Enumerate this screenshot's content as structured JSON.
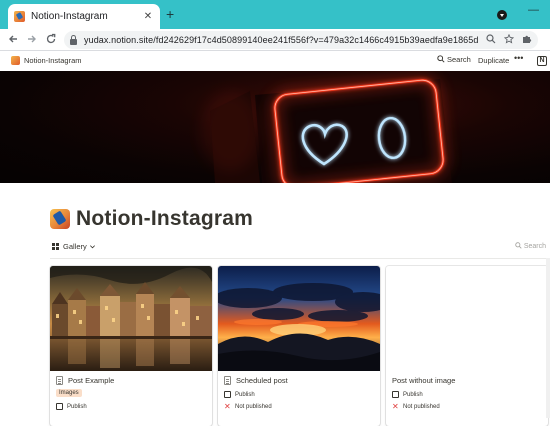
{
  "browser": {
    "tab_title": "Notion-Instagram",
    "tab_close": "✕",
    "new_tab": "+",
    "window_minimize": "—",
    "url": "yudax.notion.site/fd242629f17c4d50899140ee241f556f?v=479a32c1466c4915b39aedfa9e1865d"
  },
  "notion_topbar": {
    "breadcrumb": "Notion-Instagram",
    "search_label": "Search",
    "duplicate_label": "Duplicate",
    "more_label": "•••",
    "notion_logo": "N"
  },
  "page": {
    "title": "Notion-Instagram",
    "view_label": "Gallery",
    "view_search_placeholder": "Search"
  },
  "cards": [
    {
      "title": "Post Example",
      "tag": "Images",
      "props": [
        {
          "type": "checkbox",
          "label": "Publish"
        }
      ]
    },
    {
      "title": "Scheduled post",
      "props": [
        {
          "type": "checkbox",
          "label": "Publish"
        },
        {
          "type": "x",
          "label": "Not published"
        }
      ]
    },
    {
      "title": "Post without image",
      "props": [
        {
          "type": "checkbox",
          "label": "Publish"
        },
        {
          "type": "x",
          "label": "Not published"
        }
      ]
    }
  ],
  "colors": {
    "tab_bar": "#35c1c8",
    "neon_red": "#ff3b1f",
    "neon_blue": "#bfe6ff",
    "tag_bg": "#fadec9",
    "not_published_x": "#e03e3e"
  }
}
